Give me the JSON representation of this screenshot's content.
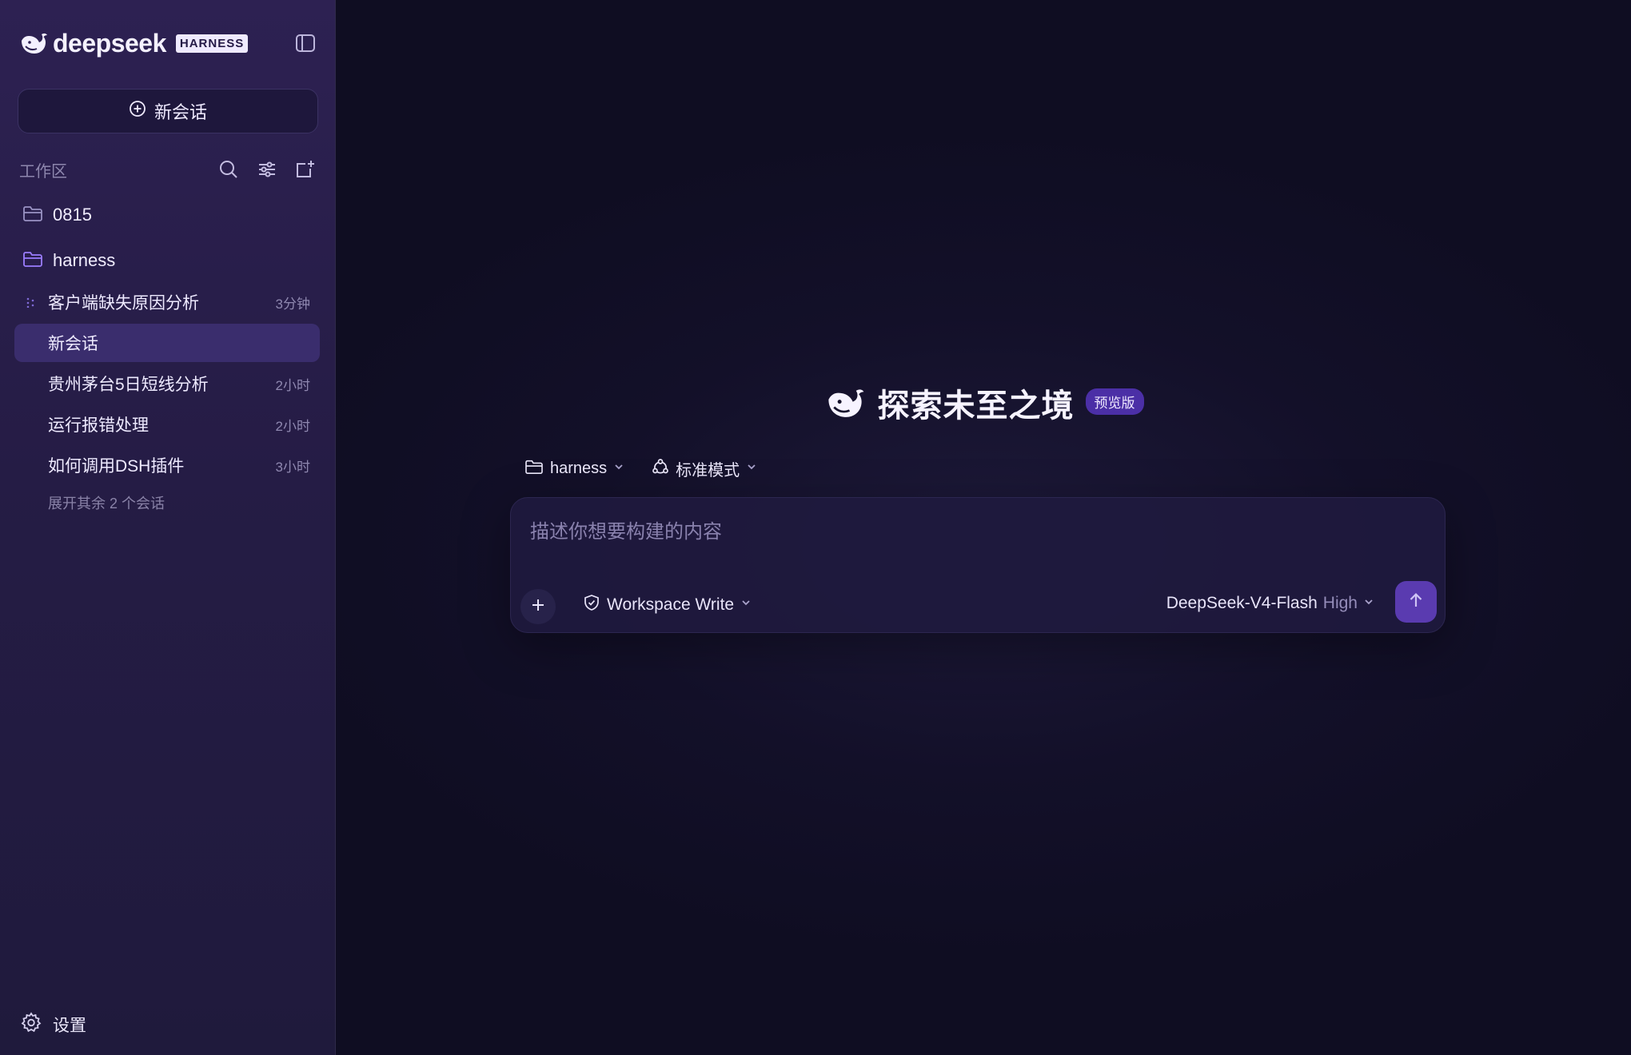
{
  "brand": {
    "name": "deepseek",
    "badge": "HARNESS"
  },
  "sidebar": {
    "new_chat_label": "新会话",
    "workspace_label": "工作区",
    "folders": [
      {
        "name": "0815"
      },
      {
        "name": "harness"
      }
    ],
    "sessions": [
      {
        "title": "客户端缺失原因分析",
        "time": "3分钟",
        "active": false
      },
      {
        "title": "新会话",
        "time": "",
        "active": true
      },
      {
        "title": "贵州茅台5日短线分析",
        "time": "2小时",
        "active": false
      },
      {
        "title": "运行报错处理",
        "time": "2小时",
        "active": false
      },
      {
        "title": "如何调用DSH插件",
        "time": "3小时",
        "active": false
      }
    ],
    "expand_more_label": "展开其余 2 个会话",
    "settings_label": "设置"
  },
  "main": {
    "hero_title": "探索未至之境",
    "hero_badge": "预览版",
    "folder_selector": "harness",
    "mode_selector": "标准模式",
    "composer": {
      "placeholder": "描述你想要构建的内容",
      "value": "",
      "permission": "Workspace Write",
      "model_name": "DeepSeek-V4-Flash",
      "model_level": "High"
    }
  },
  "colors": {
    "accent": "#5a3bb0",
    "active_session_bg": "#3a2d6d",
    "sidebar_bg": "#2a1f4d",
    "main_bg": "#0f0d22"
  }
}
